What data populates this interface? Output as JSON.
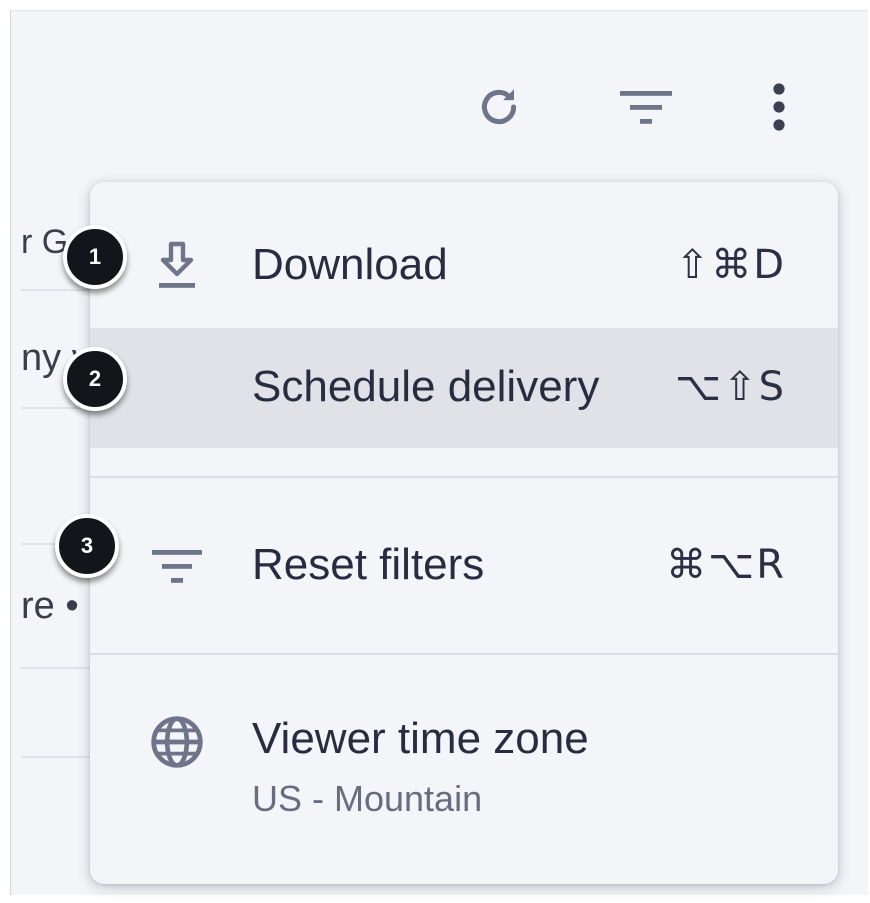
{
  "toolbar": {
    "icons": [
      "refresh-icon",
      "filter-icon",
      "more-vertical-icon"
    ]
  },
  "background": {
    "fragments": [
      "r G",
      "ny v",
      "re •"
    ]
  },
  "menu": {
    "download": {
      "label": "Download",
      "shortcut": "⇧⌘D",
      "icon": "download-icon"
    },
    "schedule": {
      "label": "Schedule delivery",
      "shortcut": "⌥⇧S"
    },
    "reset": {
      "label": "Reset filters",
      "shortcut": "⌘⌥R",
      "icon": "filter-icon"
    },
    "timezone": {
      "label": "Viewer time zone",
      "value": "US - Mountain",
      "icon": "globe-icon"
    }
  },
  "callouts": [
    "1",
    "2",
    "3"
  ],
  "colors": {
    "background": "#f4f5f8",
    "highlight": "#e0e2e7",
    "text": "#272c41",
    "muted_icon": "#6e7489",
    "badge": "#14151a"
  }
}
